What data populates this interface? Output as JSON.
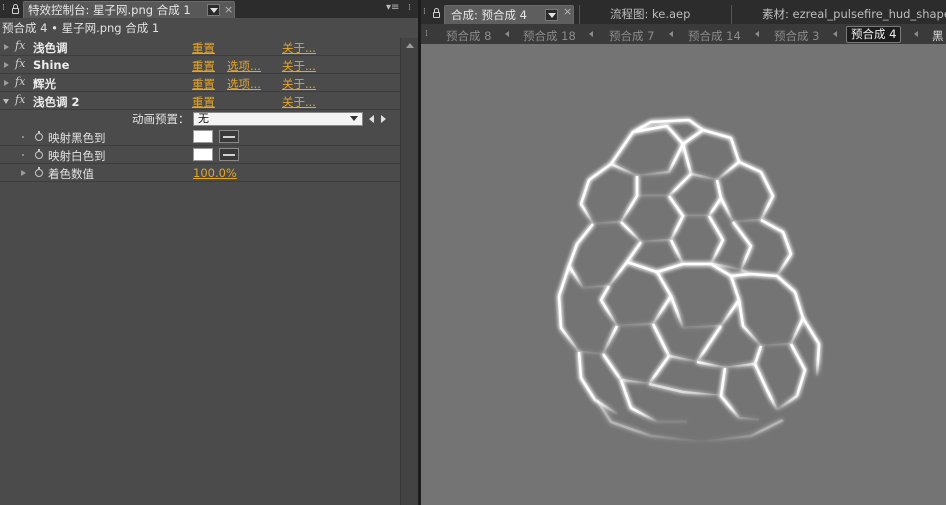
{
  "left_panel": {
    "tab_title": "特效控制台: 星子网.png 合成 1",
    "panel_menu_icon": "panel-menu-icon",
    "close_icon": "close-icon",
    "subheader": "预合成 4 • 星子网.png 合成 1",
    "effects": [
      {
        "name": "浅色调",
        "reset": "重置",
        "about": "关于...",
        "expanded": false
      },
      {
        "name": "Shine",
        "reset": "重置",
        "options": "选项...",
        "about": "关于...",
        "expanded": false
      },
      {
        "name": "辉光",
        "reset": "重置",
        "options": "选项...",
        "about": "关于...",
        "expanded": false
      },
      {
        "name": "浅色调 2",
        "reset": "重置",
        "about": "关于...",
        "expanded": true
      }
    ],
    "animation_preset": {
      "label": "动画预置：",
      "value": "无"
    },
    "properties": [
      {
        "label": "映射黑色到",
        "color": "#ffffff"
      },
      {
        "label": "映射白色到",
        "color": "#ffffff"
      },
      {
        "label": "着色数值",
        "value": "100.0%"
      }
    ]
  },
  "right_panel": {
    "tabs": [
      {
        "label": "合成: 预合成 4",
        "active": true
      },
      {
        "label": "流程图: ke.aep"
      },
      {
        "label": "素材: ezreal_pulsefire_hud_shapes"
      }
    ],
    "subtabs": [
      "预合成 8",
      "预合成 18",
      "预合成 7",
      "预合成 14",
      "预合成 3",
      "预合成 4",
      "黑"
    ],
    "active_subtab": "预合成 4",
    "viewer_background": "#747474",
    "glow_color": "#ffffff"
  }
}
